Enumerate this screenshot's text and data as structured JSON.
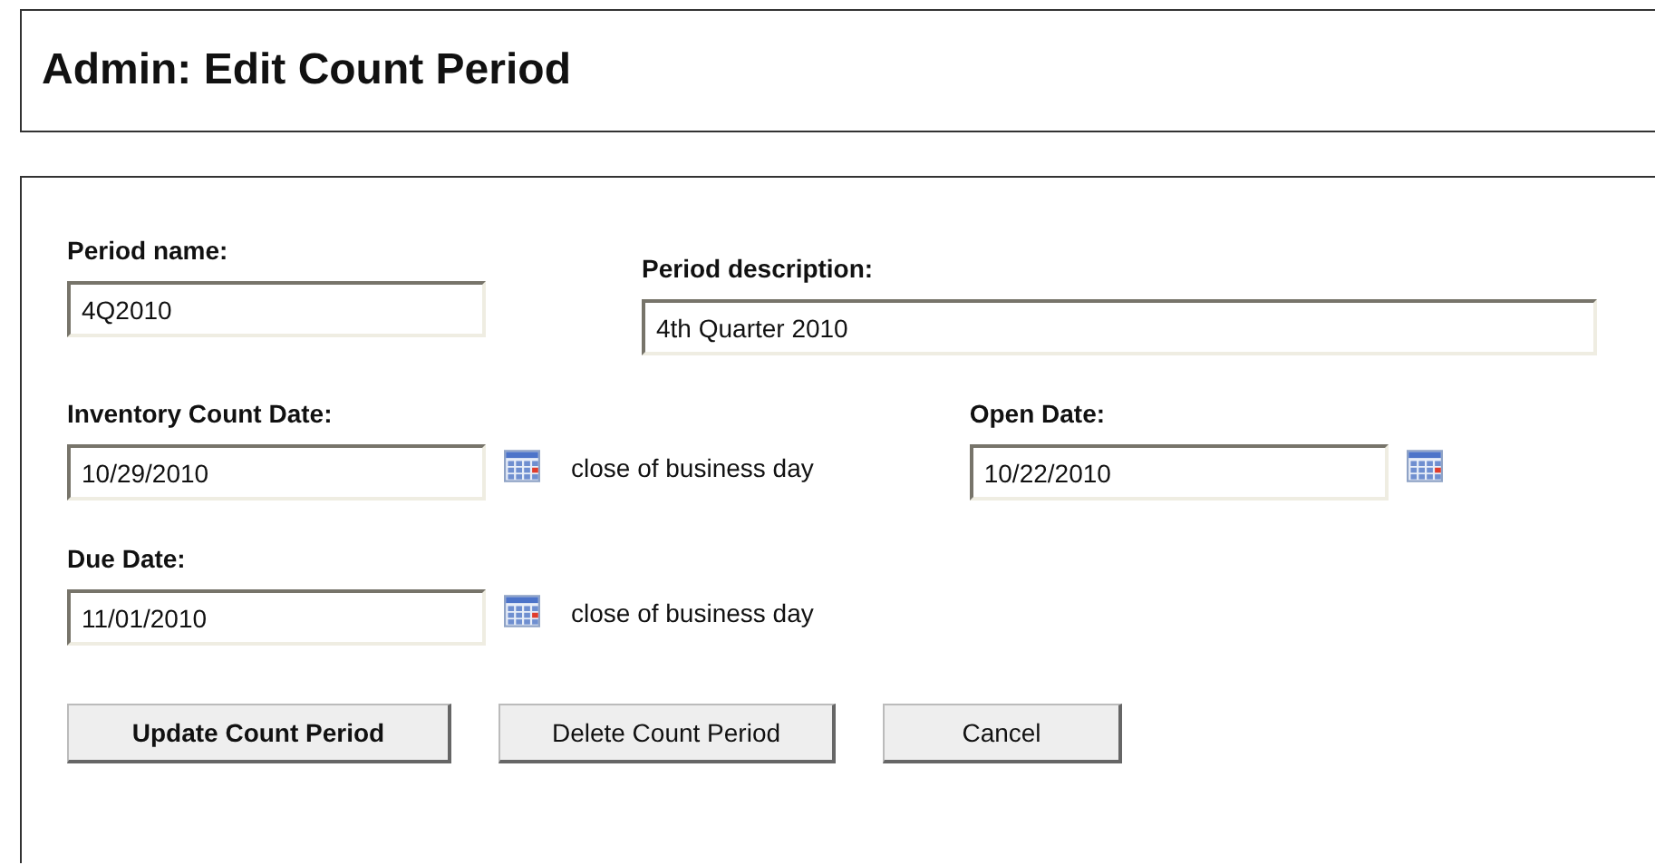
{
  "title": "Admin: Edit Count Period",
  "rows": [
    [
      {
        "kind": "text",
        "label": "Period name:",
        "value": "4Q2010"
      },
      {
        "kind": "long-text",
        "label": "Period description:",
        "value": "4th Quarter 2010"
      }
    ],
    [
      {
        "kind": "date",
        "label": "Inventory Count Date:",
        "value": "10/29/2010",
        "note": "close of business day"
      },
      {
        "kind": "date",
        "label": "Open Date:",
        "value": "10/22/2010"
      }
    ],
    [
      {
        "kind": "date",
        "label": "Due Date:",
        "value": "11/01/2010",
        "note": "close of business day"
      }
    ]
  ],
  "buttons": [
    {
      "label": "Update Count Period",
      "default": true
    },
    {
      "label": "Delete Count Period",
      "default": false
    },
    {
      "label": "Cancel",
      "default": false
    }
  ]
}
